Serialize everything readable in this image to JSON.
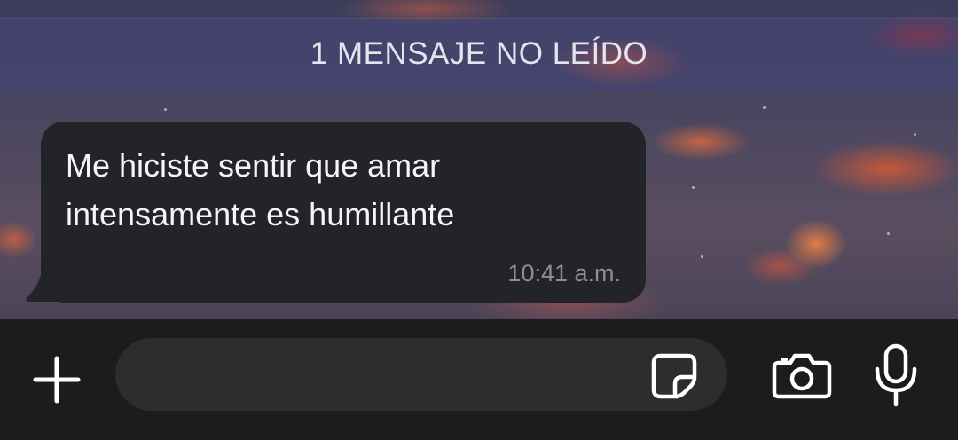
{
  "unread_banner": {
    "label": "1 MENSAJE NO LEÍDO"
  },
  "message": {
    "text": "Me hiciste sentir que amar\nintensamente es humillante",
    "time": "10:41 a.m.",
    "direction": "incoming"
  },
  "composer": {
    "value": "",
    "placeholder": ""
  },
  "icons": {
    "attach": "plus-icon",
    "sticker": "sticker-icon",
    "camera": "camera-icon",
    "microphone": "microphone-icon"
  },
  "colors": {
    "bubble": "#232427",
    "message_text": "#f5f5f7",
    "timestamp": "#8e8e93",
    "input_bar": "#1c1c1e",
    "input_field": "#2d2d30",
    "icon": "#ffffff"
  }
}
